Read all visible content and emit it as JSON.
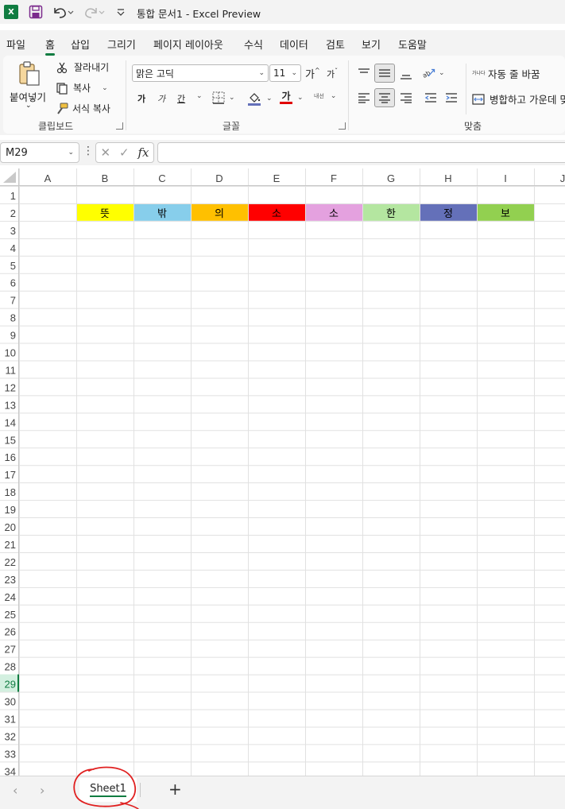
{
  "titlebar": {
    "logo": "X",
    "title": "통합 문서1  -  Excel Preview"
  },
  "menu": {
    "tabs": [
      "파일",
      "홈",
      "삽입",
      "그리기",
      "페이지 레이아웃",
      "수식",
      "데이터",
      "검토",
      "보기",
      "도움말"
    ],
    "active": "홈"
  },
  "ribbon": {
    "clipboard": {
      "paste": "붙여넣기",
      "cut": "잘라내기",
      "copy": "복사",
      "format_painter": "서식 복사",
      "label": "클립보드"
    },
    "font": {
      "family": "맑은 고딕",
      "size": "11",
      "grow": "가",
      "shrink": "가",
      "bold": "가",
      "italic": "가",
      "underline": "간",
      "font_color_glyph": "가",
      "phonetic": "내선",
      "label": "글꼴"
    },
    "alignment": {
      "wrap_text": "자동 줄 바꿈",
      "wrap_icon_text": "가나다",
      "merge_center": "병합하고 가운데 맞",
      "label": "맞춤"
    }
  },
  "formula_bar": {
    "name_box": "M29",
    "fx": "fx",
    "formula": ""
  },
  "sheet": {
    "columns": [
      "A",
      "B",
      "C",
      "D",
      "E",
      "F",
      "G",
      "H",
      "I",
      "J"
    ],
    "rows": [
      "1",
      "2",
      "3",
      "4",
      "5",
      "6",
      "7",
      "8",
      "9",
      "10",
      "11",
      "12",
      "13",
      "14",
      "15",
      "16",
      "17",
      "18",
      "19",
      "20",
      "21",
      "22",
      "23",
      "24",
      "25",
      "26",
      "27",
      "28",
      "29",
      "30",
      "31",
      "32",
      "33",
      "34"
    ],
    "active_row": "29",
    "colored_cells": [
      {
        "col": "B",
        "row": "2",
        "text": "뜻",
        "fill": "#ffff00"
      },
      {
        "col": "C",
        "row": "2",
        "text": "밖",
        "fill": "#87ceeb"
      },
      {
        "col": "D",
        "row": "2",
        "text": "의",
        "fill": "#ffc000"
      },
      {
        "col": "E",
        "row": "2",
        "text": "소",
        "fill": "#ff0000"
      },
      {
        "col": "F",
        "row": "2",
        "text": "소",
        "fill": "#e4a1df"
      },
      {
        "col": "G",
        "row": "2",
        "text": "한",
        "fill": "#b4e6a0"
      },
      {
        "col": "H",
        "row": "2",
        "text": "정",
        "fill": "#6470b9"
      },
      {
        "col": "I",
        "row": "2",
        "text": "보",
        "fill": "#92d050"
      }
    ]
  },
  "sheet_tabs": {
    "tabs": [
      "Sheet1"
    ],
    "add": "+",
    "prev": "‹",
    "next": "›"
  },
  "colors": {
    "accent": "#107c41",
    "annotation": "#e02020"
  }
}
